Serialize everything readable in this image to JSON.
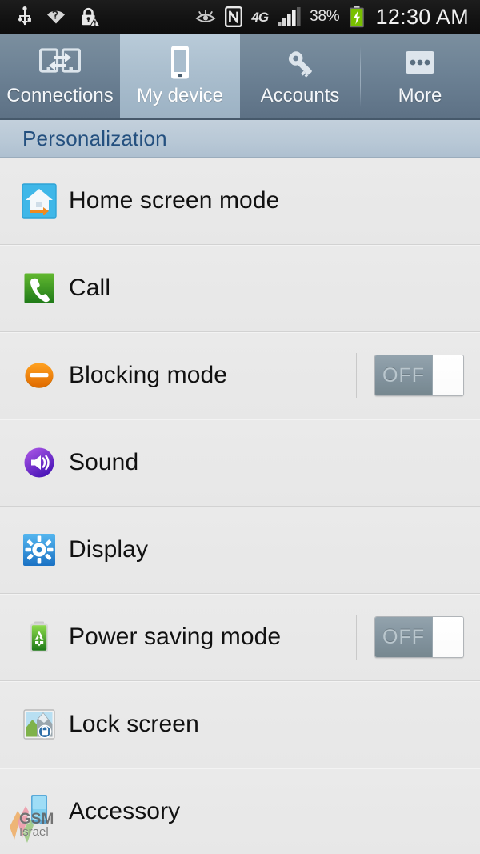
{
  "statusbar": {
    "left_icons": [
      "usb-icon",
      "wifi-question-icon",
      "lock-warning-icon"
    ],
    "right_icons": [
      "smart-stay-eye-icon",
      "nfc-icon",
      "signal-bars-icon",
      "battery-charging-icon"
    ],
    "network_type": "4G",
    "battery_percent": "38%",
    "clock": "12:30 AM"
  },
  "tabs": [
    {
      "label": "Connections",
      "icon": "connections-icon",
      "selected": false
    },
    {
      "label": "My device",
      "icon": "device-icon",
      "selected": true
    },
    {
      "label": "Accounts",
      "icon": "key-icon",
      "selected": false
    },
    {
      "label": "More",
      "icon": "more-dots-icon",
      "selected": false
    }
  ],
  "section": {
    "title": "Personalization"
  },
  "rows": [
    {
      "label": "Home screen mode",
      "icon": "home-screen-mode-icon",
      "toggle": null
    },
    {
      "label": "Call",
      "icon": "call-icon",
      "toggle": null
    },
    {
      "label": "Blocking mode",
      "icon": "blocking-mode-icon",
      "toggle": "OFF"
    },
    {
      "label": "Sound",
      "icon": "sound-icon",
      "toggle": null
    },
    {
      "label": "Display",
      "icon": "display-icon",
      "toggle": null
    },
    {
      "label": "Power saving mode",
      "icon": "power-saving-icon",
      "toggle": "OFF"
    },
    {
      "label": "Lock screen",
      "icon": "lock-screen-icon",
      "toggle": null
    },
    {
      "label": "Accessory",
      "icon": "accessory-icon",
      "toggle": null
    }
  ],
  "watermark": {
    "line1": "GSM",
    "line2": "Israel"
  },
  "colors": {
    "statusbar_bg": "#131313",
    "tabbar_bg": "#6d8295",
    "tab_selected_bg": "#a9bdcd",
    "section_bg": "#b8c8d6",
    "section_text": "#24507f",
    "list_bg": "#e9e9e9",
    "row_text": "#111111",
    "toggle_track": "#83949f"
  }
}
